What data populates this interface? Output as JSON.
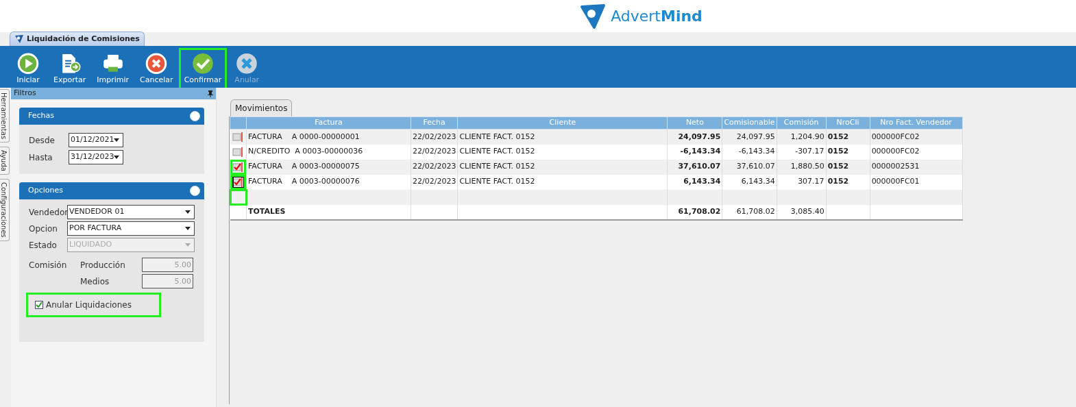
{
  "logo": {
    "text": "Advert**Mind**"
  },
  "document_tab": {
    "label": "Liquidación de Comisiones",
    "selected": true
  },
  "toolbar": [
    {
      "kind": "play",
      "label": "Iniciar",
      "disabled": false,
      "highlighted": false
    },
    {
      "kind": "export",
      "label": "Exportar",
      "disabled": false,
      "highlighted": false
    },
    {
      "kind": "print",
      "label": "Imprimir",
      "disabled": false,
      "highlighted": false
    },
    {
      "kind": "cancel",
      "label": "Cancelar",
      "disabled": false,
      "highlighted": false
    },
    {
      "kind": "confirm",
      "label": "Confirmar",
      "disabled": false,
      "highlighted": true
    },
    {
      "kind": "void",
      "label": "Anular",
      "disabled": true,
      "highlighted": false
    }
  ],
  "side_tabs": [
    "Herramientas",
    "Ayuda",
    "Configuraciones"
  ],
  "filters_panel": {
    "title": "Filtros",
    "fechas": {
      "title": "Fechas",
      "desde_label": "Desde",
      "desde": "01/12/2021",
      "hasta_label": "Hasta",
      "hasta": "31/12/2023"
    },
    "opciones": {
      "title": "Opciones",
      "fields": [
        {
          "label": "Vendedor",
          "value": "VENDEDOR 01",
          "disabled": false
        },
        {
          "label": "Opcion",
          "value": "POR FACTURA",
          "disabled": false
        },
        {
          "label": "Estado",
          "value": "LIQUIDADO",
          "disabled": true
        }
      ],
      "comision_label": "Comisión",
      "produccion_label": "Producción",
      "produccion": "5.00",
      "medios_label": "Medios",
      "medios": "5.00",
      "anular": {
        "label": "Anular Liquidaciones",
        "checked": true,
        "highlighted": true
      }
    }
  },
  "content_tab": {
    "label": "Movimientos",
    "selected": true
  },
  "table": {
    "columns": [
      "Factura",
      "Fecha",
      "Cliente",
      "Neto",
      "Comisionable",
      "Comisión",
      "NroCli",
      "Nro Fact. Vendedor"
    ],
    "rows": [
      {
        "checked": false,
        "focused": false,
        "highlighted": false,
        "cells": [
          "FACTURA    A 0000-00000001",
          "22/02/2023",
          "CLIENTE FACT. 0152",
          "24,097.95",
          "24,097.95",
          "1,204.90",
          "0152",
          "000000FC02"
        ]
      },
      {
        "checked": false,
        "focused": false,
        "highlighted": false,
        "cells": [
          "N/CREDITO  A 0003-00000036",
          "22/02/2023",
          "CLIENTE FACT. 0152",
          "-6,143.34",
          "-6,143.34",
          "-307.17",
          "0152",
          "000000FC02"
        ]
      },
      {
        "checked": true,
        "focused": false,
        "highlighted": true,
        "cells": [
          "FACTURA    A 0003-00000075",
          "22/02/2023",
          "CLIENTE FACT. 0152",
          "37,610.07",
          "37,610.07",
          "1,880.50",
          "0152",
          "0000002531"
        ]
      },
      {
        "checked": true,
        "focused": true,
        "highlighted": true,
        "cells": [
          "FACTURA    A 0003-00000076",
          "22/02/2023",
          "CLIENTE FACT. 0152",
          "6,143.34",
          "6,143.34",
          "307.17",
          "0152",
          "000000FC01"
        ]
      }
    ],
    "totals": {
      "label": "TOTALES",
      "neto": "61,708.02",
      "comisionable": "61,708.02",
      "comision": "3,085.40"
    }
  }
}
